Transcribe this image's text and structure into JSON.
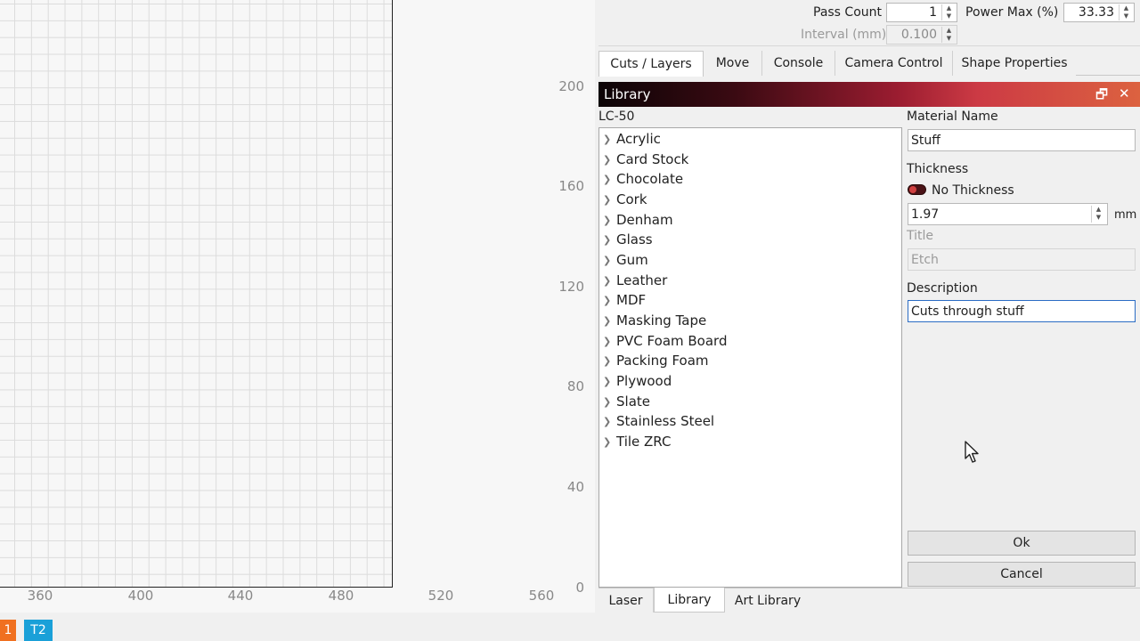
{
  "canvas": {
    "x_ticks": [
      "360",
      "400",
      "440",
      "480",
      "520",
      "560"
    ],
    "y_ticks": [
      "200",
      "160",
      "120",
      "80",
      "40",
      "0"
    ]
  },
  "settings": {
    "pass_count_label": "Pass Count",
    "pass_count_value": "1",
    "power_max_label": "Power Max (%)",
    "power_max_value": "33.33",
    "interval_label": "Interval (mm)",
    "interval_value": "0.100"
  },
  "tabs_top": [
    "Cuts / Layers",
    "Move",
    "Console",
    "Camera Control",
    "Shape Properties"
  ],
  "library": {
    "title": "Library",
    "device": "LC-50",
    "materials": [
      "Acrylic",
      "Card Stock",
      "Chocolate",
      "Cork",
      "Denham",
      "Glass",
      "Gum",
      "Leather",
      "MDF",
      "Masking Tape",
      "PVC Foam Board",
      "Packing Foam",
      "Plywood",
      "Slate",
      "Stainless Steel",
      "Tile ZRC"
    ],
    "material_name_label": "Material Name",
    "material_name_value": "Stuff",
    "thickness_label": "Thickness",
    "no_thickness_label": "No Thickness",
    "thickness_value": "1.97",
    "thickness_unit": "mm",
    "title_label": "Title",
    "title_value": "Etch",
    "description_label": "Description",
    "description_value": "Cuts through stuff",
    "ok_label": "Ok",
    "cancel_label": "Cancel"
  },
  "tabs_bottom": [
    "Laser",
    "Library",
    "Art Library"
  ],
  "status": {
    "tool_1": "1",
    "tool_2": "T2"
  },
  "colors": {
    "tool_1": "#f07020",
    "tool_2": "#1aa0d8",
    "header_start": "#0c0406",
    "header_end": "#dc6240"
  },
  "icons": {
    "restore": "restore-window-icon",
    "close": "close-icon",
    "chevron": "chevron-right-icon"
  }
}
